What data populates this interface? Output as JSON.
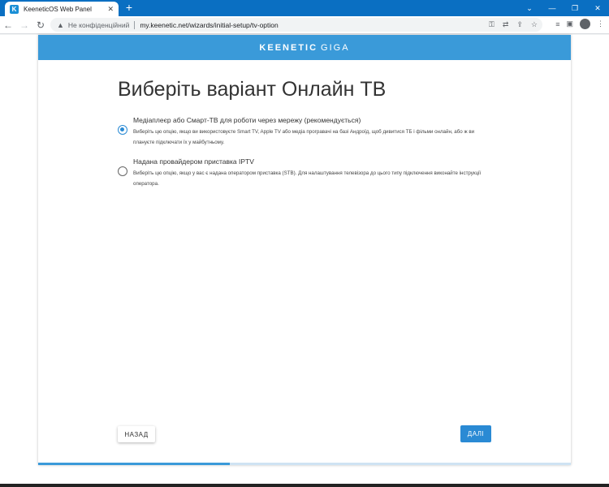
{
  "browser": {
    "tab_title": "KeeneticOS Web Panel",
    "favicon_letter": "K",
    "security_text": "Не конфіденційний",
    "url": "my.keenetic.net/wizards/initial-setup/tv-option"
  },
  "page": {
    "brand": "KEENETIC",
    "brand_model": "GIGA",
    "title": "Виберіть варіант Онлайн ТВ",
    "options": [
      {
        "label": "Медіаплеєр або Смарт-ТВ для роботи через мережу (рекомендується)",
        "description": "Виберіть цю опцію, якщо ви використовуєте Smart TV, Apple TV або медіа програвачі на базі Андроїд, щоб дивитися ТБ і фільми онлайн, або ж ви плануєте підключати їх у майбутньому.",
        "selected": true
      },
      {
        "label": "Надана провайдером приставка IPTV",
        "description": "Виберіть цю опцію, якщо у вас є надана оператором приставка (STB). Для налаштування телевізора до цього типу підключення виконайте інструкції оператора.",
        "selected": false
      }
    ],
    "back_label": "НАЗАД",
    "next_label": "ДАЛІ",
    "progress_fraction": 0.36
  },
  "colors": {
    "accent": "#3a9ad9",
    "button": "#2a8ad4"
  }
}
